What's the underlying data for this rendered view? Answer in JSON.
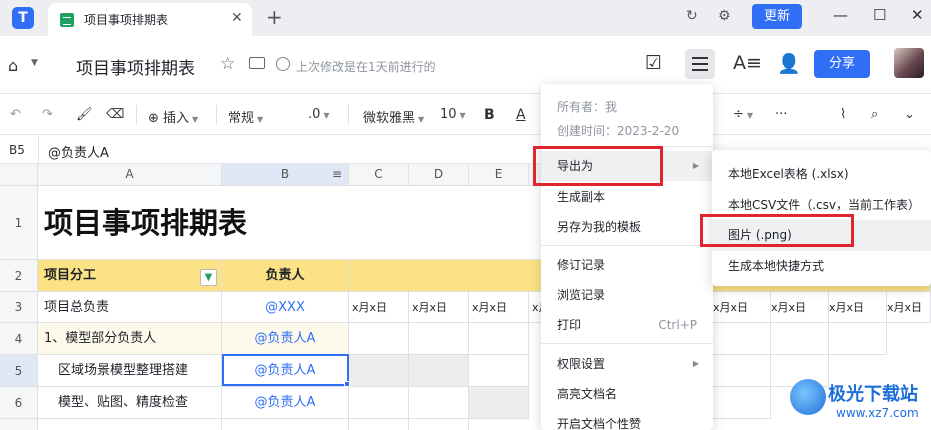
{
  "tabbar": {
    "tab_title": "项目事项排期表",
    "close_glyph": "✕",
    "add_glyph": "+",
    "update_label": "更新",
    "icons": [
      "refresh-icon",
      "settings-icon",
      "minimize-icon",
      "maximize-icon",
      "close-window-icon"
    ]
  },
  "header": {
    "doc_title": "项目事项排期表",
    "saved_text": "上次修改是在1天前进行的",
    "share_label": "分享"
  },
  "toolbar": {
    "insert_label": "插入",
    "format_label": "常规",
    "decimal_label": ".0",
    "font_label": "微软雅黑",
    "size_label": "10",
    "bold_label": "B",
    "color_label": "A"
  },
  "formula_bar": {
    "cell_ref": "B5",
    "value": "@负责人A"
  },
  "sheet": {
    "columns": [
      "A",
      "B",
      "C",
      "D",
      "E"
    ],
    "rows": [
      "1",
      "2",
      "3",
      "4",
      "5",
      "6"
    ],
    "title": "项目事项排期表",
    "header_a": "项目分工",
    "header_b": "负责人",
    "date_placeholder": "x月x日",
    "cells": {
      "a3": "项目总负责",
      "b3": "@XXX",
      "a4": "1、模型部分负责人",
      "b4": "@负责人A",
      "a5": "区域场景模型整理搭建",
      "b5": "@负责人A",
      "a6": "模型、贴图、精度检查",
      "b6": "@负责人A"
    }
  },
  "menu": {
    "owner": "所有者：我",
    "created": "创建时间：2023-2-20",
    "items": {
      "export": "导出为",
      "copy": "生成副本",
      "save_template": "另存为我的模板",
      "revisions": "修订记录",
      "browse_history": "浏览记录",
      "print": "打印",
      "print_shortcut": "Ctrl+P",
      "permissions": "权限设置",
      "highlight_name": "高亮文档名",
      "personalize": "开启文档个性赞"
    }
  },
  "submenu": {
    "excel": "本地Excel表格 (.xlsx)",
    "csv": "本地CSV文件（.csv，当前工作表）",
    "image": "图片 (.png)",
    "shortcut": "生成本地快捷方式"
  },
  "watermark": {
    "name": "极光下载站",
    "url": "www.xz7.com"
  },
  "colors": {
    "accent": "#2f6ef5",
    "highlight_red": "#e0262c",
    "header_yellow": "#fbe385"
  }
}
